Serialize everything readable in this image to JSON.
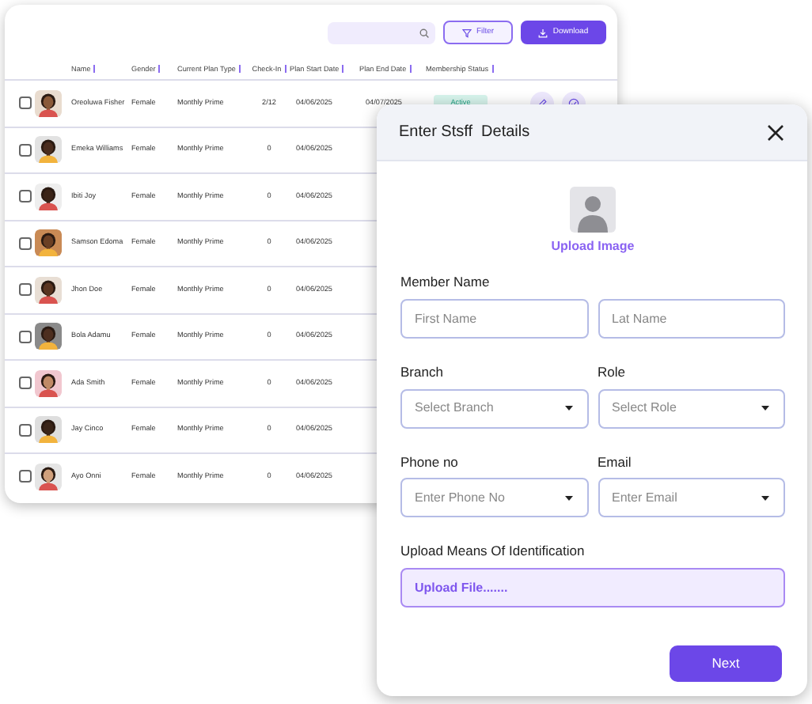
{
  "toolbar": {
    "filter_button": "Filter",
    "download_button": "Download"
  },
  "table": {
    "columns": [
      "Name",
      "Gender",
      "Current Plan Type",
      "Check-In",
      "Plan Start Date",
      "Plan End Date",
      "Membership Status"
    ],
    "rows": [
      {
        "checked": false,
        "name": "Oreoluwa Fisher",
        "gender": "Female",
        "plan_type": "Monthly Prime",
        "check_in": "2/12",
        "start_date": "04/06/2025",
        "end_date": "04/07/2025",
        "status": "Active",
        "actions": true
      },
      {
        "checked": false,
        "name": "Emeka Williams",
        "gender": "Female",
        "plan_type": "Monthly Prime",
        "check_in": "0",
        "start_date": "04/06/2025"
      },
      {
        "checked": false,
        "name": "Ibiti Joy",
        "gender": "Female",
        "plan_type": "Monthly Prime",
        "check_in": "0",
        "start_date": "04/06/2025"
      },
      {
        "checked": false,
        "name": "Samson Edoma",
        "gender": "Female",
        "plan_type": "Monthly Prime",
        "check_in": "0",
        "start_date": "04/06/2025"
      },
      {
        "checked": false,
        "name": "Jhon Doe",
        "gender": "Female",
        "plan_type": "Monthly Prime",
        "check_in": "0",
        "start_date": "04/06/2025"
      },
      {
        "checked": false,
        "name": "Bola Adamu",
        "gender": "Female",
        "plan_type": "Monthly Prime",
        "check_in": "0",
        "start_date": "04/06/2025"
      },
      {
        "checked": false,
        "name": "Ada Smith",
        "gender": "Female",
        "plan_type": "Monthly Prime",
        "check_in": "0",
        "start_date": "04/06/2025"
      },
      {
        "checked": false,
        "name": "Jay Cinco",
        "gender": "Female",
        "plan_type": "Monthly Prime",
        "check_in": "0",
        "start_date": "04/06/2025"
      },
      {
        "checked": false,
        "name": "Ayo Onni",
        "gender": "Female",
        "plan_type": "Monthly Prime",
        "check_in": "0",
        "start_date": "04/06/2025"
      }
    ]
  },
  "modal": {
    "title": "Enter Stsff  Details",
    "upload_image_link": "Upload Image",
    "groups": [
      {
        "label": "Member Name",
        "fields": [
          {
            "kind": "input",
            "placeholder": "First Name"
          },
          {
            "kind": "input",
            "placeholder": "Lat Name"
          }
        ]
      },
      {
        "label": "Branch",
        "fields": [
          {
            "kind": "select",
            "placeholder": "Select Branch"
          }
        ]
      },
      {
        "label": "Role",
        "fields": [
          {
            "kind": "select",
            "placeholder": "Select Role"
          }
        ]
      },
      {
        "label": "Phone no",
        "fields": [
          {
            "kind": "select",
            "placeholder": "Enter Phone No"
          }
        ]
      },
      {
        "label": "Email",
        "fields": [
          {
            "kind": "select",
            "placeholder": "Enter Email"
          }
        ]
      }
    ],
    "upload_label": "Upload Means Of Identification",
    "upload_field": "Upload File.......",
    "next_button": "Next"
  }
}
